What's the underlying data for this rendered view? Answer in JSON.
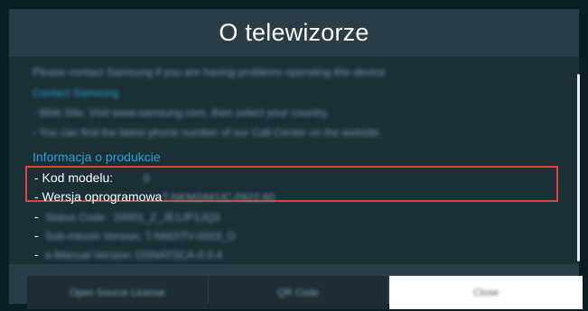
{
  "dialog": {
    "title": "O telewizorze"
  },
  "body": {
    "line1": "Please contact Samsung if you are having problems operating this device.",
    "line2": "Contact Samsung",
    "line3": "- Web Site: Visit www.samsung.com, then select your country.",
    "line4": "- You can find the latest phone number of our Call Center on the website.",
    "section_heading": "Informacja o produkcie",
    "model_label": "- Kod modelu:",
    "model_value": "0",
    "software_label": "- Wersja oprogramowa",
    "software_value": "T-NKM2AKUC-0922.60",
    "status_line": "Status Code : 20001_Z_JE1JP1JQ3",
    "micom_line": "Sub-micom Version: T-NM2ITV-0003_D",
    "manual_line": "e-Manual Version: OSNATSCA-0.0.4",
    "dash": "-"
  },
  "buttons": {
    "open_source": "Open Source License",
    "qr_code": "QR Code",
    "close": "Close"
  }
}
